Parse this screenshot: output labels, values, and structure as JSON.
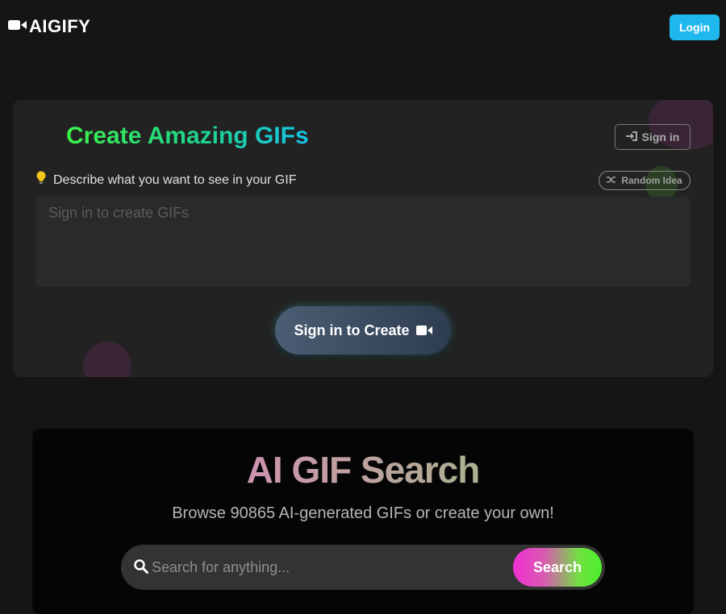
{
  "header": {
    "brand": "AIGIFY",
    "login_label": "Login"
  },
  "create": {
    "title": "Create Amazing GIFs",
    "signin_label": "Sign in",
    "prompt_label": "Describe what you want to see in your GIF",
    "random_label": "Random Idea",
    "prompt_placeholder": "Sign in to create GIFs",
    "create_button": "Sign in to Create"
  },
  "search": {
    "title": "AI GIF Search",
    "subtitle": "Browse 90865 AI-generated GIFs or create your own!",
    "placeholder": "Search for anything...",
    "button": "Search"
  },
  "colors": {
    "background": "#151515",
    "card": "#222222",
    "login_accent": "#1eb8ec",
    "title_green": "#3df04a",
    "title_cyan": "#16c3e8",
    "search_pink": "#f02fd2",
    "search_green": "#4bf02c"
  },
  "icons": {
    "brand": "video-camera-icon",
    "signin": "sign-in-icon",
    "prompt": "lightbulb-icon",
    "random": "shuffle-icon",
    "create": "video-camera-icon",
    "search": "search-icon"
  }
}
